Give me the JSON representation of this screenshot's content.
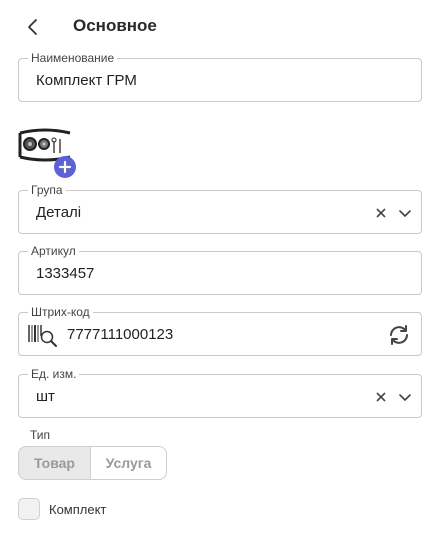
{
  "header": {
    "title": "Основное"
  },
  "fields": {
    "name": {
      "label": "Наименование",
      "value": "Комплект ГРМ"
    },
    "group": {
      "label": "Група",
      "value": "Деталі"
    },
    "article": {
      "label": "Артикул",
      "value": "1333457"
    },
    "barcode": {
      "label": "Штрих-код",
      "value": "7777111000123"
    },
    "unit": {
      "label": "Ед. изм.",
      "value": "шт"
    }
  },
  "type": {
    "label": "Тип",
    "options": [
      "Товар",
      "Услуга"
    ],
    "selected": "Товар"
  },
  "kit": {
    "label": "Комплект",
    "checked": false
  },
  "colors": {
    "accent": "#5c61d6",
    "border": "#c9c9c9"
  }
}
